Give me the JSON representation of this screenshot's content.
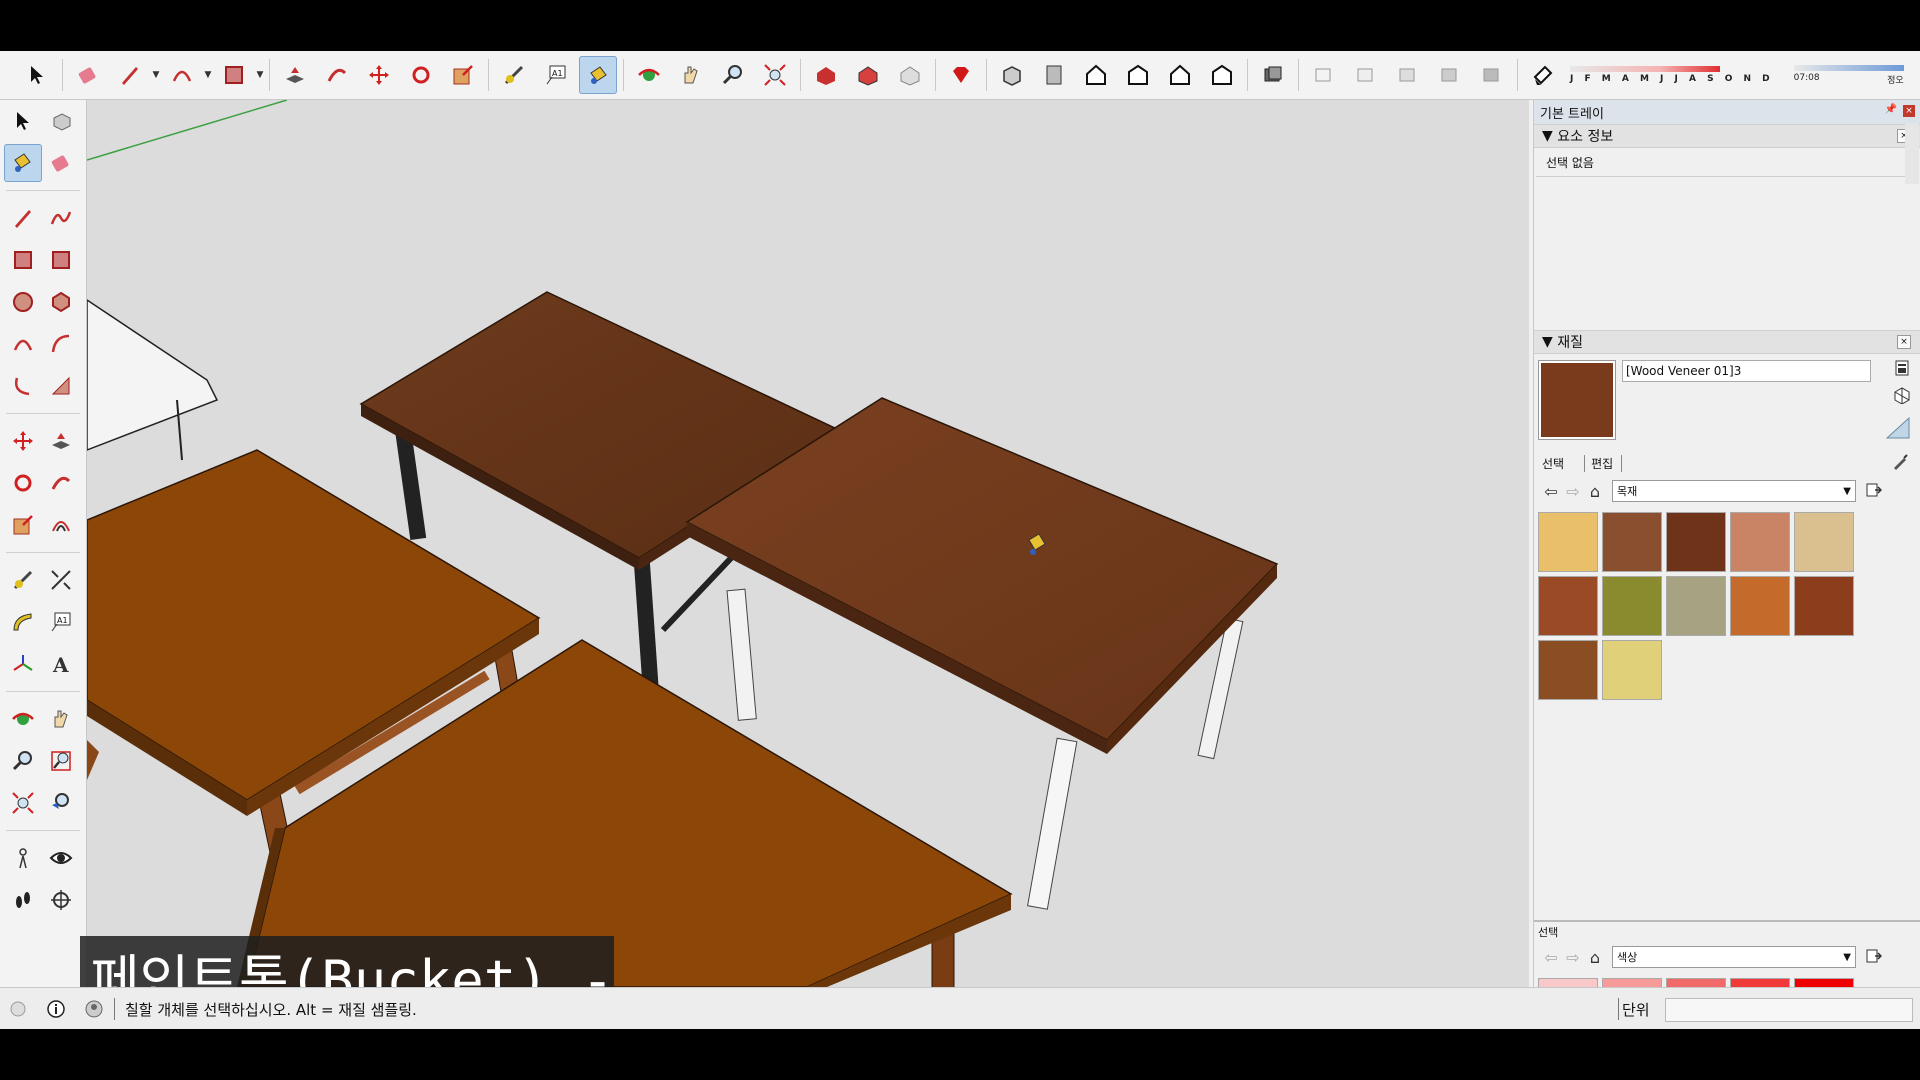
{
  "toolbar": {
    "months_label": "J F M A M J J A S O N D",
    "time_label": "07:08",
    "noon_label": "정오"
  },
  "tray": {
    "title": "기본 트레이",
    "entity_info": {
      "header": "요소 정보",
      "selection": "선택 없음"
    },
    "materials": {
      "header": "재질",
      "name": "[Wood Veneer 01]3",
      "swatch_color": "#7a3a1c",
      "tab_select": "선택",
      "tab_edit": "편집",
      "library": "목재",
      "swatches": [
        "#e9bf6a",
        "#8a4f2e",
        "#6e3318",
        "#c98466",
        "#d9c08e",
        "#9a4a24",
        "#8a8a2e",
        "#a7a282",
        "#c46a2a",
        "#8c3e1c",
        "#8a4e22",
        "#e0d07a"
      ],
      "secondary_label": "선택",
      "secondary_library": "색상",
      "secondary_swatches": [
        "#f9c8c8",
        "#f79a9a",
        "#f06a6a",
        "#f03a3a",
        "#ee0000"
      ]
    }
  },
  "viewport": {
    "caption": "페인트통(Bucket) - B"
  },
  "status": {
    "message": "칠할 개체를 선택하십시오. Alt = 재질 샘플링.",
    "units_label": "단위"
  }
}
